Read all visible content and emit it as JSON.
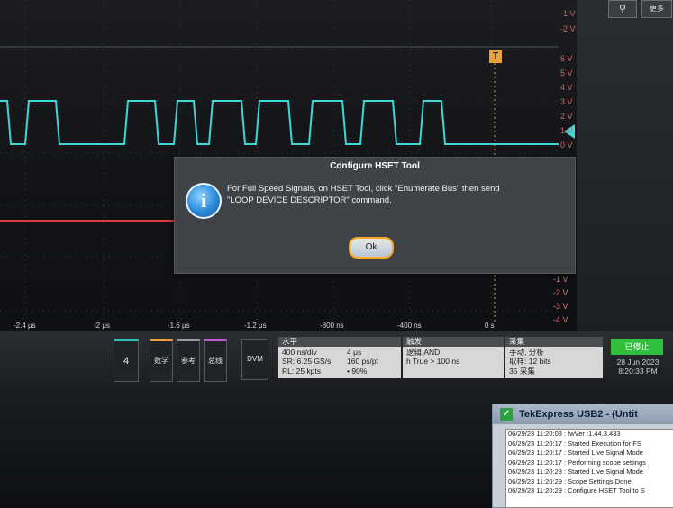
{
  "scope": {
    "top_right_buttons": [
      "",
      "更多"
    ],
    "right_scale_top": [
      "-1 V",
      "-2 V"
    ],
    "right_scale_ch1": [
      "6 V",
      "5 V",
      "4 V",
      "3 V",
      "2 V",
      "1 V",
      "0 V"
    ],
    "right_scale_bottom": [
      "-1 V",
      "-2 V",
      "-3 V",
      "-4 V"
    ],
    "trigger_marker": "T",
    "time_labels": [
      "-2.4 μs",
      "-2 μs",
      "-1.6 μs",
      "-1.2 μs",
      "-800 ns",
      "-400 ns",
      "0 s"
    ]
  },
  "dialog": {
    "title": "Configure HSET Tool",
    "message_line1": "For Full Speed Signals, on HSET Tool, click \"Enumerate Bus\" then send",
    "message_line2": "\"LOOP DEVICE DESCRIPTOR\" command.",
    "ok_label": "Ok",
    "icon": "info-icon",
    "icon_glyph": "i"
  },
  "bottom_bar": {
    "channel_count": "4",
    "buttons": [
      "数学",
      "参考",
      "总线",
      "DVM"
    ],
    "button_accent_colors": [
      "#2ec4b6",
      "#f0a23a",
      "#9aa0a6",
      "#c05ad6"
    ],
    "horizontal": {
      "header": "水平",
      "rows": [
        [
          "400 ns/div",
          "4 μs"
        ],
        [
          "SR: 6.25 GS/s",
          "160 ps/pt"
        ],
        [
          "RL: 25 kpts",
          "• 90%"
        ]
      ]
    },
    "trigger": {
      "header": "触发",
      "rows": [
        "逻辑  AND",
        "h True > 100 ns"
      ]
    },
    "acquisition": {
      "header": "采集",
      "rows": [
        "手动,        分析",
        "取样: 12 bits",
        "35 采集"
      ]
    },
    "status": "已停止",
    "date": "28 Jun 2023",
    "time": "8:20:33 PM"
  },
  "tekexpress": {
    "title": "TekExpress USB2 - (Untit",
    "log": [
      "06/29/23 11:20:08 : fwVer :1.44.3.433",
      "06/29/23 11:20:17 : Started Execution for FS",
      "06/29/23 11:20:17 : Started Live Signal Mode",
      "06/29/23 11:20:17 : Performing scope settings",
      "06/29/23 11:20:29 : Started Live Signal Mode",
      "06/29/23 11:20:29 : Scope Settings Done",
      "06/29/23 11:20:29 : Configure HSET Tool to S"
    ]
  },
  "colors": {
    "trace_ch1": "#3fd6d6",
    "trace_ch2": "#e23b3b",
    "status_green": "#2fbf3c"
  }
}
